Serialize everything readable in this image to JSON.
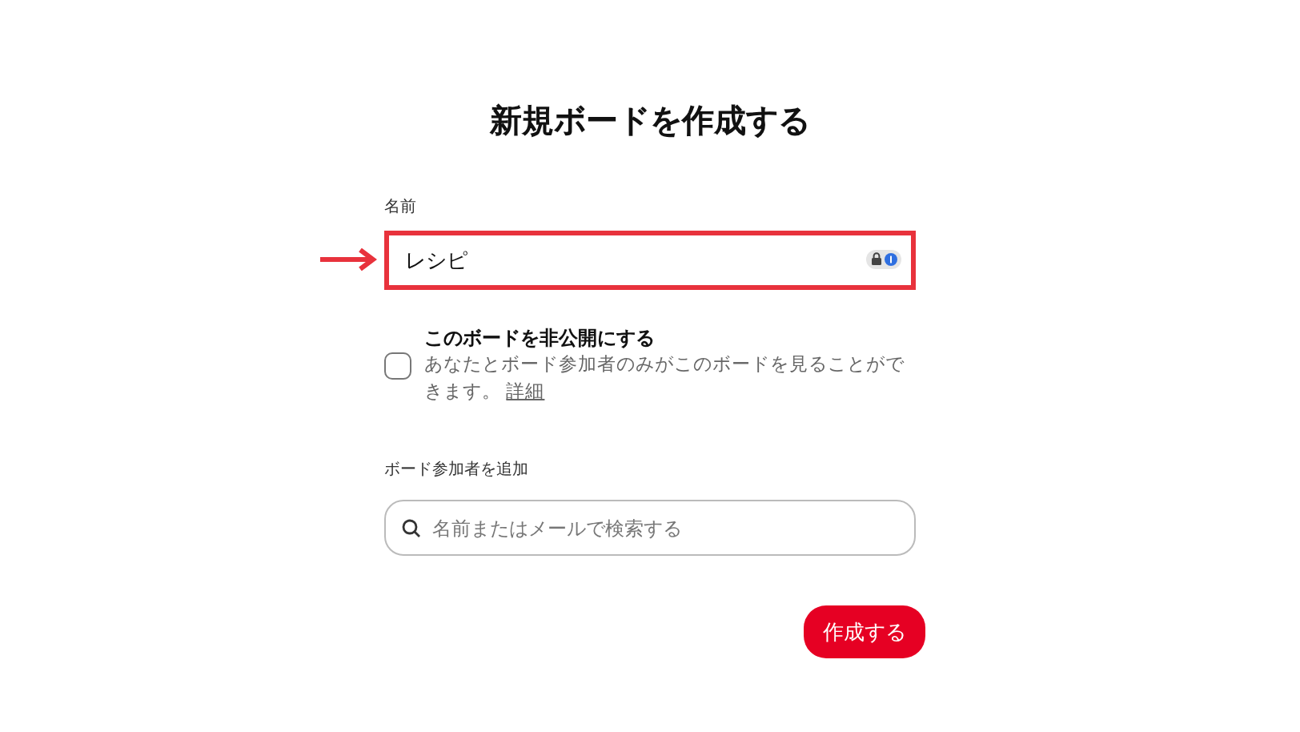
{
  "title": "新規ボードを作成する",
  "name_field": {
    "label": "名前",
    "value": "レシピ",
    "highlighted": true
  },
  "secret": {
    "checked": false,
    "title": "このボードを非公開にする",
    "description": "あなたとボード参加者のみがこのボードを見ることができます。",
    "link": "詳細"
  },
  "collaborators": {
    "label": "ボード参加者を追加",
    "placeholder": "名前またはメールで検索する"
  },
  "buttons": [
    "作成する"
  ]
}
